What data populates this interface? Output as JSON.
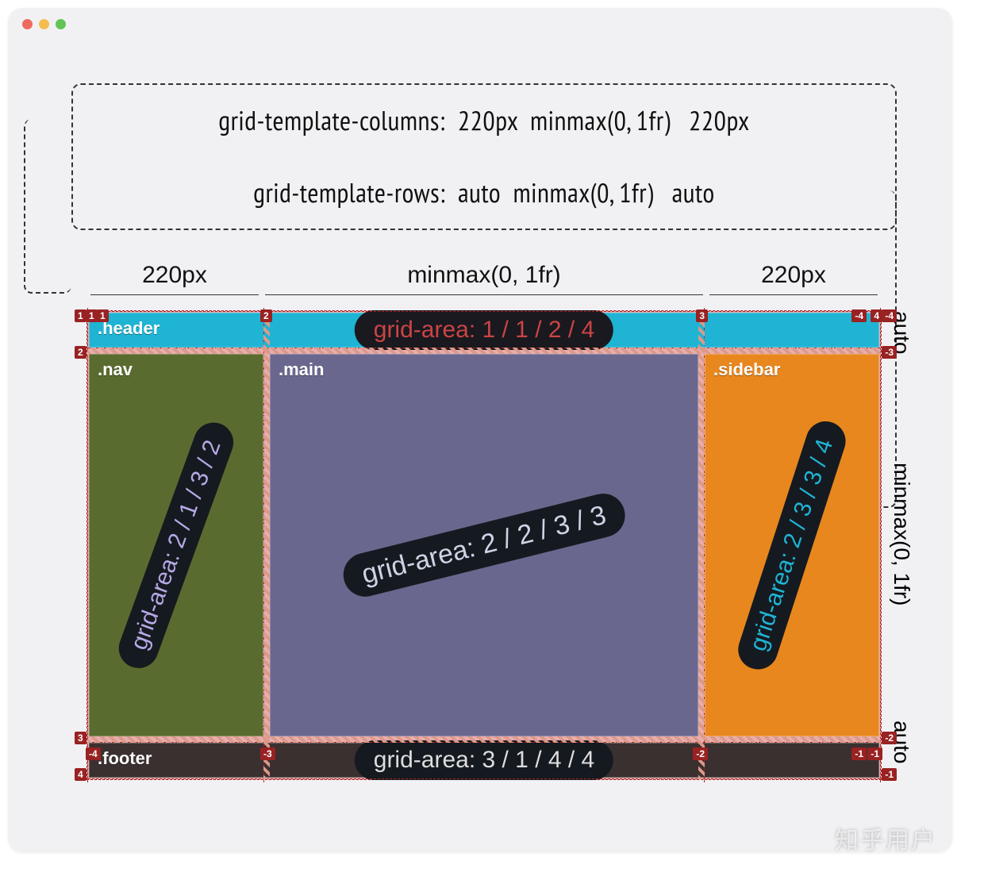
{
  "templates": {
    "columns_line": "grid-template-columns:  220px  minmax(0, 1fr)   220px",
    "rows_line": "grid-template-rows:  auto  minmax(0, 1fr)   auto"
  },
  "column_labels": [
    "220px",
    "minmax(0, 1fr)",
    "220px"
  ],
  "row_labels": [
    "auto",
    "minmax(0, 1fr)",
    "auto"
  ],
  "areas": {
    "header": {
      "name": ".header",
      "area": "grid-area: 1 / 1 / 2 / 4"
    },
    "nav": {
      "name": ".nav",
      "area": "grid-area: 2 / 1 / 3 / 2"
    },
    "main": {
      "name": ".main",
      "area": "grid-area: 2 / 2 / 3 / 3"
    },
    "sidebar": {
      "name": ".sidebar",
      "area": "grid-area: 2 / 3 / 3 / 4"
    },
    "footer": {
      "name": ".footer",
      "area": "grid-area: 3 / 1 / 4 / 4"
    }
  },
  "line_badges": {
    "cols_top": [
      "1",
      "2",
      "3",
      "-4",
      "4"
    ],
    "cols_bottom": [
      "-4",
      "-3",
      "-2",
      "-1",
      "-1"
    ],
    "rows_left": [
      "1",
      "2",
      "3",
      "4"
    ],
    "rows_right": [
      "-4",
      "-3",
      "-2",
      "-1"
    ]
  },
  "watermark": "知乎用户"
}
